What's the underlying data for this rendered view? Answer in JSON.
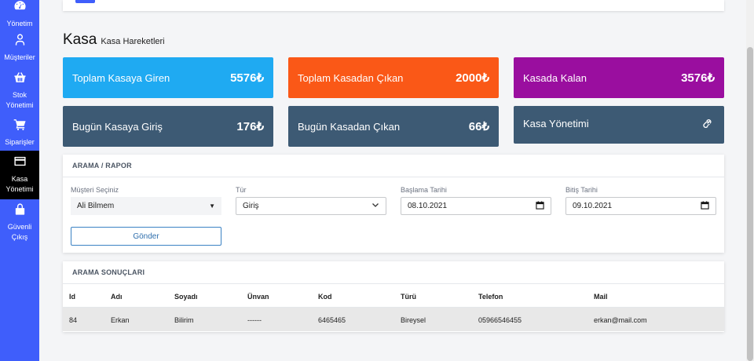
{
  "sidebar": {
    "items": [
      {
        "label": "Yönetim",
        "icon": "gauge-icon"
      },
      {
        "label": "Müşteriler",
        "icon": "user-icon"
      },
      {
        "label": "Stok Yönetimi",
        "icon": "basket-icon"
      },
      {
        "label": "Siparişler",
        "icon": "cart-icon"
      },
      {
        "label": "Kasa Yönetimi",
        "icon": "wallet-icon"
      },
      {
        "label": "Güvenli Çıkış",
        "icon": "lock-icon"
      }
    ]
  },
  "page": {
    "title": "Kasa",
    "subtitle": "Kasa Hareketleri"
  },
  "cards": [
    {
      "label": "Toplam Kasaya Giren",
      "value": "5576₺",
      "color": "#1faaf2"
    },
    {
      "label": "Toplam Kasadan Çıkan",
      "value": "2000₺",
      "color": "#fa5817"
    },
    {
      "label": "Kasada Kalan",
      "value": "3576₺",
      "color": "#9a0e9f"
    },
    {
      "label": "Bugün Kasaya Giriş",
      "value": "176₺",
      "color": "#3d5a74"
    },
    {
      "label": "Bugün Kasadan Çıkan",
      "value": "66₺",
      "color": "#3d5a74"
    },
    {
      "label": "Kasa Yönetimi",
      "icon": "link-icon",
      "color": "#3d5a74"
    }
  ],
  "search": {
    "title": "ARAMA / RAPOR",
    "customer_label": "Müşteri Seçiniz",
    "customer_value": "Ali Bilmem",
    "type_label": "Tür",
    "type_value": "Giriş",
    "start_label": "Başlama Tarihi",
    "start_value": "08.10.2021",
    "end_label": "Bitiş Tarihi",
    "end_value": "09.10.2021",
    "submit_label": "Gönder"
  },
  "results": {
    "title": "ARAMA SONUÇLARI",
    "columns": [
      "Id",
      "Adı",
      "Soyadı",
      "Ünvan",
      "Kod",
      "Türü",
      "Telefon",
      "Mail"
    ],
    "rows": [
      [
        "84",
        "Erkan",
        "Bilirim",
        "------",
        "6465465",
        "Bireysel",
        "05966546455",
        "erkan@mail.com"
      ]
    ]
  }
}
